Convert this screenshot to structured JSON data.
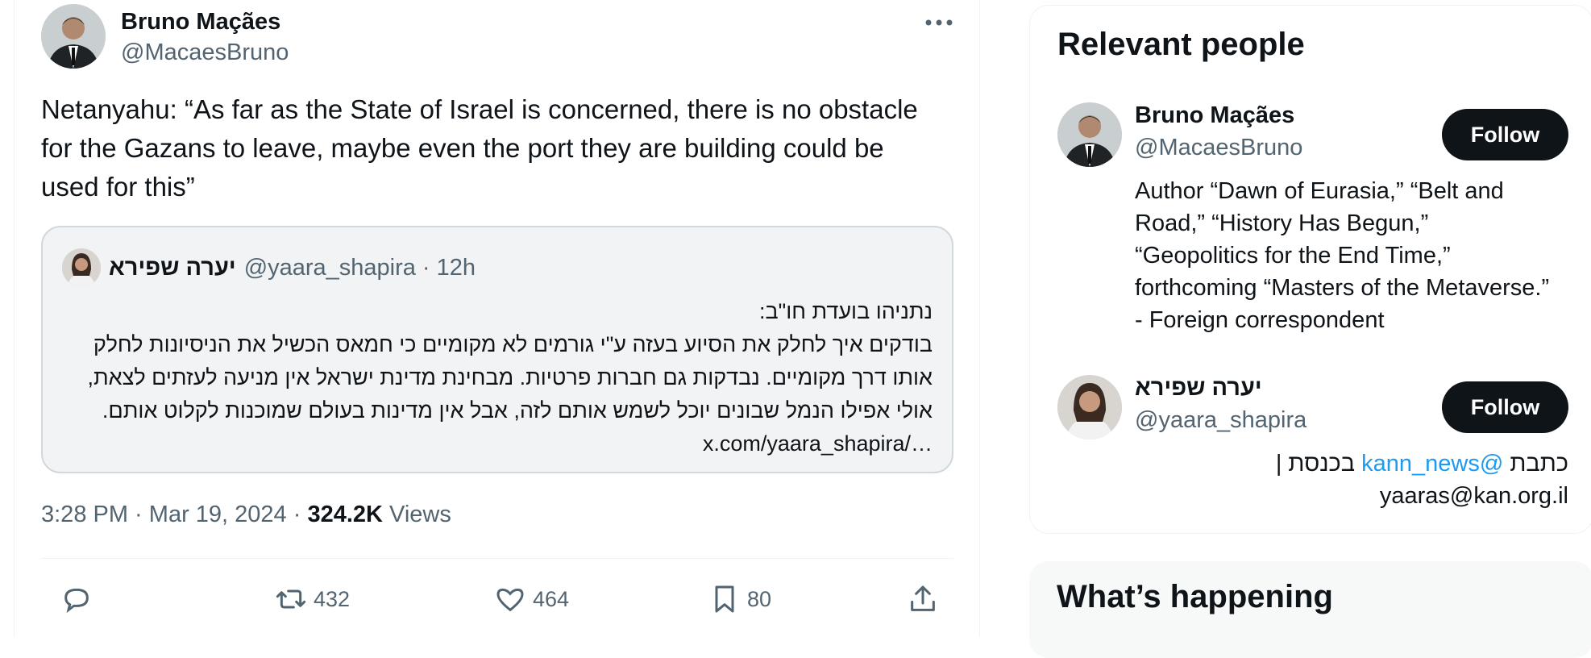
{
  "tweet": {
    "author": {
      "name": "Bruno Maçães",
      "handle": "@MacaesBruno"
    },
    "text": "Netanyahu: “As far as the State of Israel is concerned, there is no obstacle for the Gazans to leave, maybe even the port they are building could be used for this”",
    "quote": {
      "name": "יערה שפירא",
      "handle": "@yaara_shapira",
      "dot": "·",
      "time": "12h",
      "lines": [
        "נתניהו בועדת חו\"ב:",
        "בודקים איך לחלק את הסיוע בעזה ע\"י גורמים לא מקומיים כי חמאס הכשיל את הניסיונות לחלק",
        "אותו דרך מקומיים. נבדקות גם חברות פרטיות. מבחינת מדינת ישראל אין מניעה לעזתים לצאת,",
        "אולי אפילו הנמל שבונים יוכל לשמש אותם לזה, אבל אין מדינות בעולם שמוכנות לקלוט אותם.",
        "x.com/yaara_shapira/…"
      ]
    },
    "meta": {
      "time": "3:28 PM",
      "sep1": " · ",
      "date": "Mar 19, 2024",
      "sep2": " · ",
      "views": "324.2K",
      "views_label": " Views"
    },
    "actions": {
      "replies": "",
      "reposts": "432",
      "likes": "464",
      "bookmarks": "80"
    }
  },
  "sidebar": {
    "relevant_people": {
      "title": "Relevant people",
      "people": [
        {
          "name": "Bruno Maçães",
          "handle": "@MacaesBruno",
          "follow_label": "Follow",
          "bio": "Author “Dawn of Eurasia,” “Belt and Road,” “History Has Begun,” “Geopolitics for the End Time,” forthcoming “Masters of the Metaverse.” - Foreign correspondent"
        },
        {
          "name": "יערה שפירא",
          "handle": "@yaara_shapira",
          "follow_label": "Follow",
          "bio_prefix": "כתבת ",
          "bio_mention": "@kann_news",
          "bio_suffix": " בכנסת |",
          "bio_line2": "yaaras@kan.org.il"
        }
      ]
    },
    "whats_happening": {
      "title": "What’s happening"
    }
  },
  "colors": {
    "text": "#0f1419",
    "muted": "#536471",
    "link": "#1d9bf0",
    "button": "#0f1419"
  }
}
